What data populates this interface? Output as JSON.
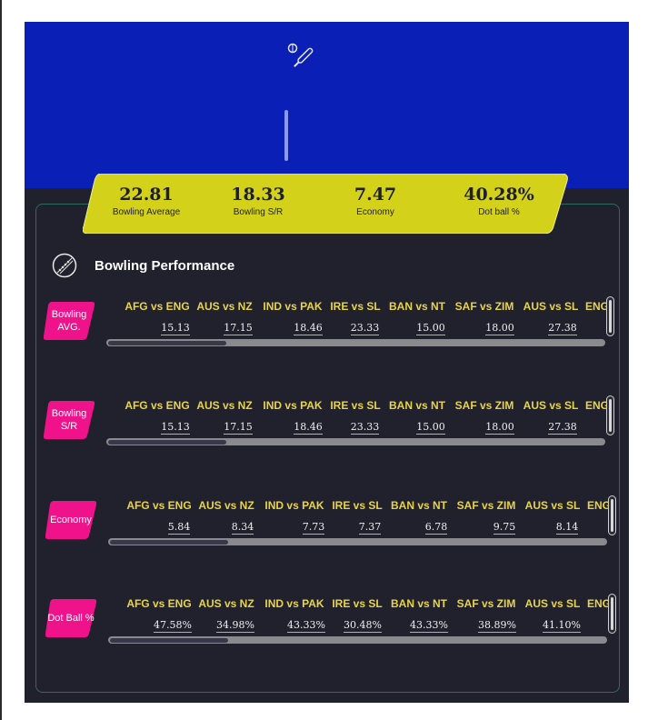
{
  "colors": {
    "hero_bg": "#0a1fb5",
    "app_bg": "#20212c",
    "stat_bar": "#d3d11a",
    "badge": "#f0128a",
    "match_header": "#e8d44a",
    "panel_border": "#2f6b63"
  },
  "hero": {
    "icon": "cricket-bat-ball-icon"
  },
  "stats": [
    {
      "value": "22.81",
      "label": "Bowling Average"
    },
    {
      "value": "18.33",
      "label": "Bowling S/R"
    },
    {
      "value": "7.47",
      "label": "Economy"
    },
    {
      "value": "40.28%",
      "label": "Dot ball %"
    }
  ],
  "performance": {
    "icon": "cricket-ball-icon",
    "title": "Bowling Performance"
  },
  "matches": [
    "AFG vs ENG",
    "AUS vs NZ",
    "IND vs PAK",
    "IRE vs SL",
    "BAN vs NT",
    "SAF vs ZIM",
    "AUS vs SL",
    "ENG"
  ],
  "metrics": [
    {
      "label": "Bowling AVG.",
      "values": [
        "15.13",
        "17.15",
        "18.46",
        "23.33",
        "15.00",
        "18.00",
        "27.38",
        ""
      ]
    },
    {
      "label": "Bowling S/R",
      "values": [
        "15.13",
        "17.15",
        "18.46",
        "23.33",
        "15.00",
        "18.00",
        "27.38",
        ""
      ]
    },
    {
      "label": "Economy",
      "values": [
        "5.84",
        "8.34",
        "7.73",
        "7.37",
        "6.78",
        "9.75",
        "8.14",
        ""
      ]
    },
    {
      "label": "Dot Ball %",
      "values": [
        "47.58%",
        "34.98%",
        "43.33%",
        "30.48%",
        "43.33%",
        "38.89%",
        "41.10%",
        ""
      ]
    }
  ]
}
